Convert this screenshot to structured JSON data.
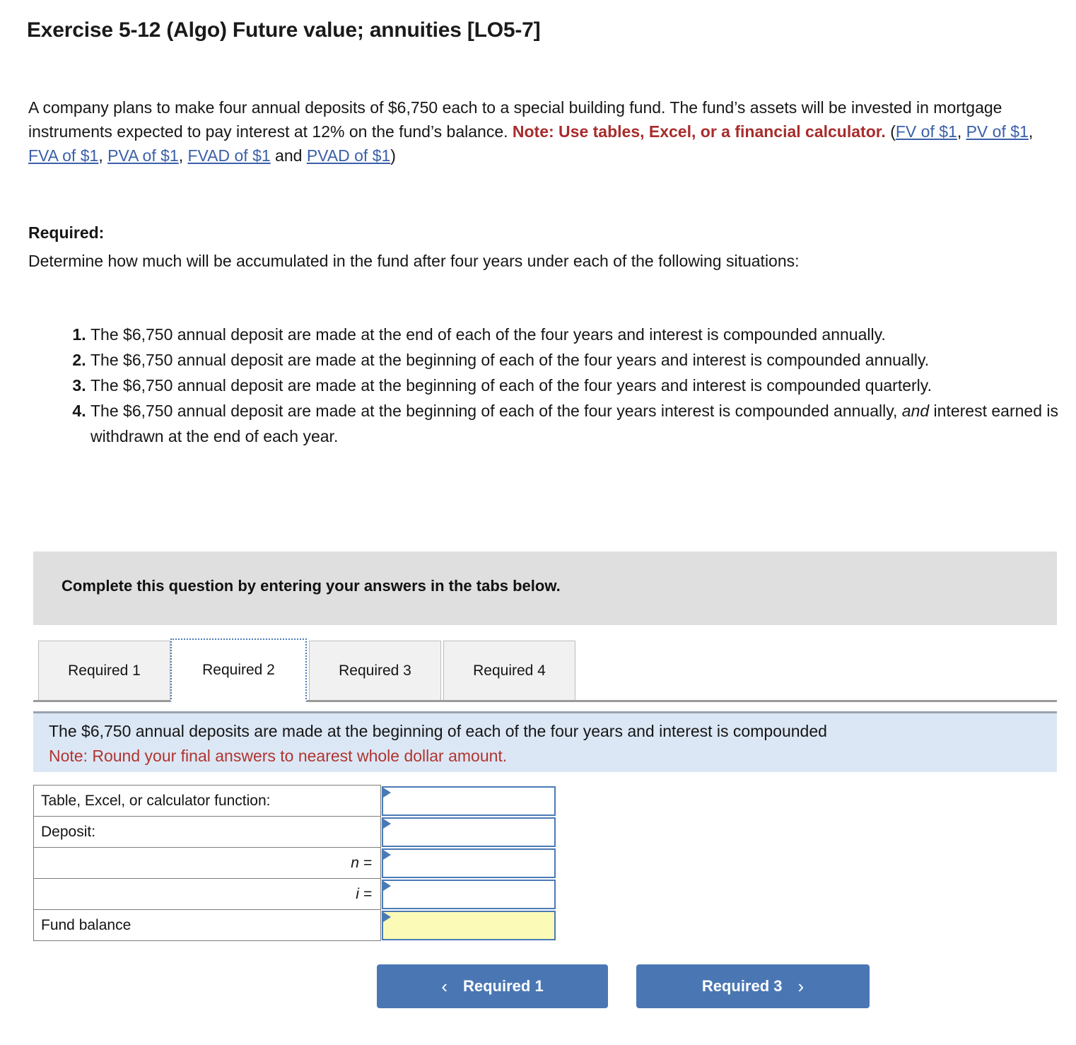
{
  "title": "Exercise 5-12 (Algo) Future value; annuities [LO5-7]",
  "intro": {
    "line1": "A company plans to make four annual deposits of $6,750 each to a special building fund. The fund’s",
    "line2": "assets will be invested in mortgage instruments expected to pay interest at 12% on the fund’s balance.",
    "note_label": "Note: Use tables, Excel, or a financial calculator.",
    "paren_open": " (",
    "links": [
      "FV of $1",
      "PV of $1",
      "FVA of $1",
      "PVA of $1",
      "FVAD of $1",
      "PVAD of $1"
    ],
    "sep": ", ",
    "and_text": "and ",
    "paren_close": ")"
  },
  "required": {
    "heading": "Required:",
    "description": "Determine how much will be accumulated in the fund after four years under each of the following situations:",
    "items": [
      "The $6,750 annual deposit are made at the end of each of the four years and interest is compounded annually.",
      "The $6,750 annual deposit are made at the beginning of each of the four years and interest is compounded annually.",
      "The $6,750 annual deposit are made at the beginning of each of the four years and interest is compounded quarterly.",
      "The $6,750 annual deposit are made at the beginning of each of the four years interest is compounded annually, and interest earned is withdrawn at the end of each year."
    ],
    "item4_pre": "The $6,750 annual deposit are made at the beginning of each of the four years interest is compounded annually, ",
    "item4_italic": "and",
    "item4_post": " interest earned is withdrawn at the end of each year."
  },
  "gray_banner": {
    "text": "Complete this question by entering your answers in the tabs below."
  },
  "tabs": {
    "active_index": 1,
    "items": [
      {
        "label": "Required 1"
      },
      {
        "label": "Required 2"
      },
      {
        "label": "Required 3"
      },
      {
        "label": "Required 4"
      }
    ]
  },
  "info_banner": {
    "line1": "The $6,750 annual deposits are made at the beginning of each of the four years and interest is compounded",
    "line2": "Note: Round your final answers to nearest whole dollar amount."
  },
  "answer_table": {
    "rows": [
      {
        "label": "Table, Excel, or calculator function:",
        "align": "left",
        "value": "",
        "highlight": false
      },
      {
        "label": "Deposit:",
        "align": "left",
        "value": "",
        "highlight": false
      },
      {
        "label": "n =",
        "align": "right",
        "value": "",
        "highlight": false,
        "italic_label": true
      },
      {
        "label": "i =",
        "align": "right",
        "value": "",
        "highlight": false,
        "italic_label": true
      },
      {
        "label": "Fund balance",
        "align": "left",
        "value": "",
        "highlight": true
      }
    ]
  },
  "nav": {
    "prev_label": "Required 1",
    "next_label": "Required 3",
    "prev_icon": "‹",
    "next_icon": "›"
  },
  "colors": {
    "accent_blue": "#4a77b4",
    "note_red": "#a82c2c",
    "link_blue": "#3b5fa8",
    "info_bg": "#dce7f5",
    "gray_bg": "#dfdfdf",
    "highlight_yellow": "#fbfbb7"
  }
}
